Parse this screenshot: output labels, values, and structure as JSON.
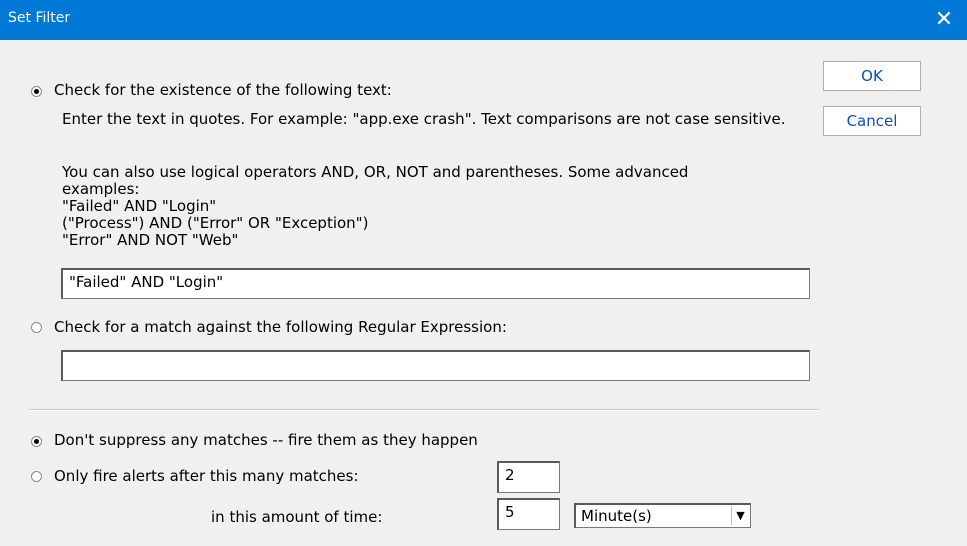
{
  "window": {
    "title": "Set Filter",
    "close_glyph": "✕"
  },
  "buttons": {
    "ok": "OK",
    "cancel": "Cancel"
  },
  "option_text": {
    "label": "Check for the existence of the following text:",
    "desc1": "Enter the text in quotes.  For example: \"app.exe crash\".   Text comparisons are not case sensitive.",
    "desc2_line1": "You can also use logical operators AND, OR, NOT and parentheses.  Some advanced",
    "desc2_line2": "examples:",
    "ex1": "\"Failed\" AND \"Login\"",
    "ex2": "(\"Process\") AND (\"Error\" OR \"Exception\")",
    "ex3": "\"Error\" AND NOT \"Web\"",
    "value": "\"Failed\" AND \"Login\"",
    "checked": true
  },
  "option_regex": {
    "label": "Check for a match against the following Regular Expression:",
    "value": "",
    "checked": false
  },
  "suppress": {
    "none_label": "Don't suppress any matches -- fire them as they happen",
    "only_label": "Only fire alerts after this many matches:",
    "time_label": "in this amount of time:",
    "matches_value": "2",
    "time_value": "5",
    "unit": "Minute(s)",
    "none_checked": true
  }
}
